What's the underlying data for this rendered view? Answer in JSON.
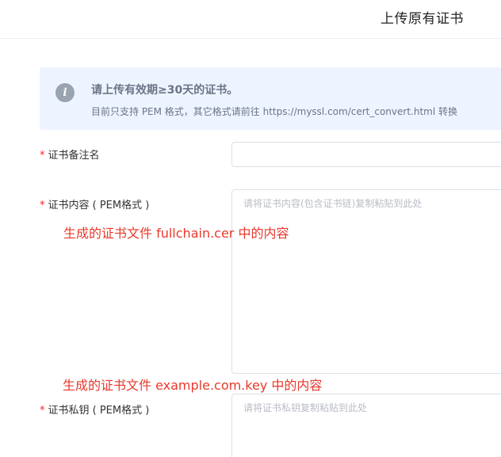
{
  "header": {
    "title": "上传原有证书"
  },
  "notice": {
    "icon": "info-icon",
    "icon_glyph": "i",
    "title": "请上传有效期≥30天的证书。",
    "subtitle": "目前只支持 PEM 格式，其它格式请前往 https://myssl.com/cert_convert.html 转换"
  },
  "form": {
    "required_mark": "*",
    "cert_name": {
      "label": "证书备注名",
      "value": "",
      "placeholder": ""
    },
    "cert_content": {
      "label": "证书内容 ( PEM格式 )",
      "value": "",
      "placeholder": "请将证书内容(包含证书链)复制粘贴到此处"
    },
    "cert_key": {
      "label": "证书私钥 ( PEM格式 )",
      "value": "",
      "placeholder": "请将证书私钥复制粘贴到此处"
    }
  },
  "annotations": {
    "content_hint": "生成的证书文件 fullchain.cer 中的内容",
    "key_hint": "生成的证书文件 example.com.key 中的内容"
  },
  "colors": {
    "notice_bg": "#eef4ff",
    "required": "#f5222d",
    "annotation": "#e8382c"
  }
}
